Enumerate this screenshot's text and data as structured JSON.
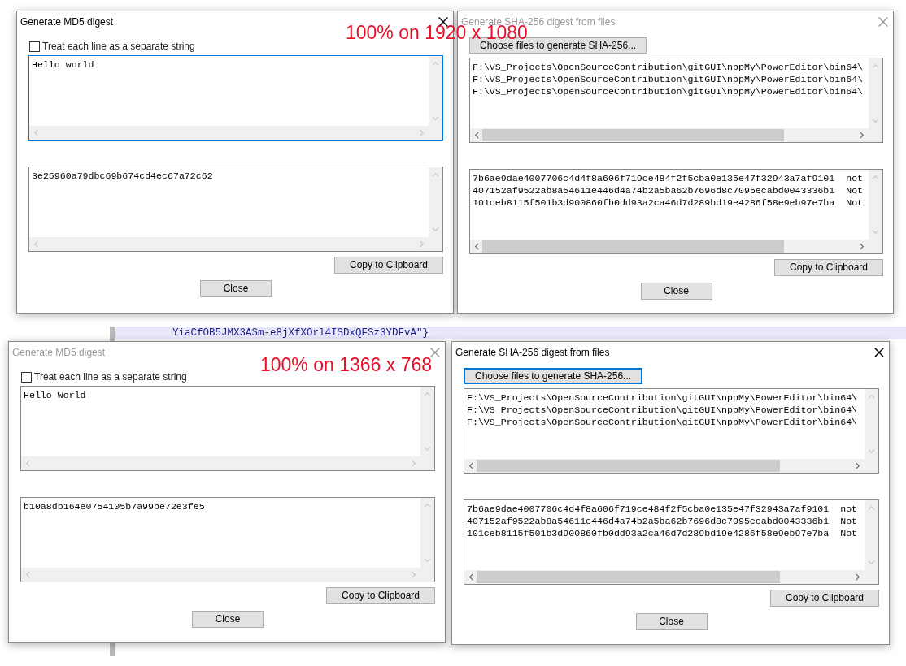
{
  "background_editor": {
    "text": "YiaCfOB5JMX3ASm-e8jXfXOrl4ISDxQFSz3YDFvA\"}"
  },
  "dialogs": [
    {
      "kind": "md5",
      "title": "Generate MD5 digest",
      "active": true,
      "checkbox": {
        "label": "Treat each line as a separate string",
        "checked": false
      },
      "input": {
        "lines": [
          "Hello world"
        ],
        "focused": true
      },
      "output": {
        "lines": [
          "3e25960a79dbc69b674cd4ec67a72c62"
        ]
      },
      "copy_button": "Copy to Clipboard",
      "close_button": "Close"
    },
    {
      "kind": "sha256",
      "title": "Generate SHA-256 digest from files",
      "active": false,
      "choose_button": {
        "label": "Choose files to generate SHA-256...",
        "focused": false
      },
      "input": {
        "lines": [
          "F:\\VS_Projects\\OpenSourceContribution\\gitGUI\\nppMy\\PowerEditor\\bin64\\",
          "F:\\VS_Projects\\OpenSourceContribution\\gitGUI\\nppMy\\PowerEditor\\bin64\\",
          "F:\\VS_Projects\\OpenSourceContribution\\gitGUI\\nppMy\\PowerEditor\\bin64\\"
        ],
        "focused": false
      },
      "output": {
        "lines": [
          "7b6ae9dae4007706c4d4f8a606f719ce484f2f5cba0e135e47f32943a7af9101  not",
          "407152af9522ab8a54611e446d4a74b2a5ba62b7696d8c7095ecabd0043336b1  Not",
          "101ceb8115f501b3d900860fb0dd93a2ca46d7d289bd19e4286f58e9eb97e7ba  Not"
        ]
      },
      "copy_button": "Copy to Clipboard",
      "close_button": "Close"
    },
    {
      "kind": "md5",
      "title": "Generate MD5 digest",
      "active": false,
      "checkbox": {
        "label": "Treat each line as a separate string",
        "checked": false
      },
      "input": {
        "lines": [
          "Hello World"
        ],
        "focused": false
      },
      "output": {
        "lines": [
          "b10a8db164e0754105b7a99be72e3fe5"
        ]
      },
      "copy_button": "Copy to Clipboard",
      "close_button": "Close"
    },
    {
      "kind": "sha256",
      "title": "Generate SHA-256 digest from files",
      "active": true,
      "choose_button": {
        "label": "Choose files to generate SHA-256...",
        "focused": true
      },
      "input": {
        "lines": [
          "F:\\VS_Projects\\OpenSourceContribution\\gitGUI\\nppMy\\PowerEditor\\bin64\\",
          "F:\\VS_Projects\\OpenSourceContribution\\gitGUI\\nppMy\\PowerEditor\\bin64\\",
          "F:\\VS_Projects\\OpenSourceContribution\\gitGUI\\nppMy\\PowerEditor\\bin64\\"
        ],
        "focused": false
      },
      "output": {
        "lines": [
          "7b6ae9dae4007706c4d4f8a606f719ce484f2f5cba0e135e47f32943a7af9101  not",
          "407152af9522ab8a54611e446d4a74b2a5ba62b7696d8c7095ecabd0043336b1  Not",
          "101ceb8115f501b3d900860fb0dd93a2ca46d7d289bd19e4286f58e9eb97e7ba  Not"
        ]
      },
      "copy_button": "Copy to Clipboard",
      "close_button": "Close"
    }
  ],
  "annotations": [
    "100% on 1920 x 1080",
    "100% on 1366 x 768"
  ]
}
